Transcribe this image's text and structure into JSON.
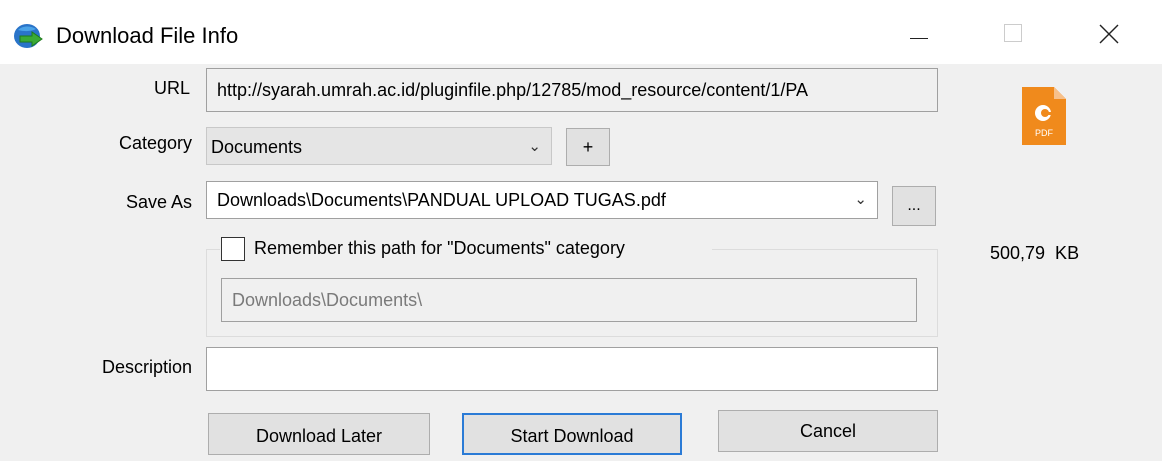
{
  "window": {
    "title": "Download File Info",
    "controls": {
      "minimize": "minimize",
      "maximize": "maximize",
      "close": "close"
    }
  },
  "form": {
    "url_label": "URL",
    "url_value": "http://syarah.umrah.ac.id/pluginfile.php/12785/mod_resource/content/1/PA",
    "category_label": "Category",
    "category_value": "Documents",
    "add_category_label": "+",
    "save_as_label": "Save As",
    "save_as_value": "Downloads\\Documents\\PANDUAL UPLOAD TUGAS.pdf",
    "browse_label": "...",
    "remember_label": "Remember this path for \"Documents\" category",
    "remember_checked": false,
    "remember_path_value": "Downloads\\Documents\\",
    "description_label": "Description",
    "description_value": ""
  },
  "file": {
    "icon": "pdf-file-icon",
    "size": "500,79  KB"
  },
  "buttons": {
    "download_later": "Download Later",
    "start_download": "Start Download",
    "cancel": "Cancel"
  },
  "colors": {
    "accent": "#2b7bd6",
    "pdf_orange": "#f08a1c"
  }
}
